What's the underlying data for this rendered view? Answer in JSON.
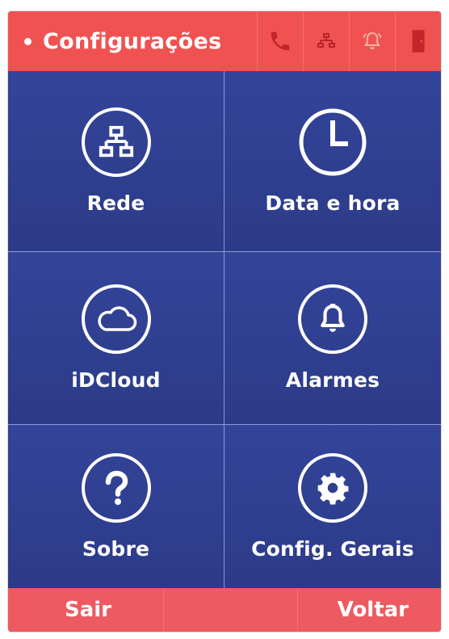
{
  "header": {
    "title": "Configurações",
    "status_icons": [
      "phone-icon",
      "network-icon",
      "alarm-bell-icon",
      "door-icon"
    ]
  },
  "tiles": [
    {
      "label": "Rede",
      "icon": "network-icon"
    },
    {
      "label": "Data e hora",
      "icon": "clock-icon"
    },
    {
      "label": "iDCloud",
      "icon": "cloud-icon"
    },
    {
      "label": "Alarmes",
      "icon": "bell-icon"
    },
    {
      "label": "Sobre",
      "icon": "question-icon"
    },
    {
      "label": "Config. Gerais",
      "icon": "gear-icon"
    }
  ],
  "footer": {
    "left_label": "Sair",
    "right_label": "Voltar"
  },
  "colors": {
    "header_red": "#f05252",
    "footer_red": "#ee5a62",
    "tile_blue": "#2f3f8d",
    "status_icon_red": "#c0262a"
  }
}
